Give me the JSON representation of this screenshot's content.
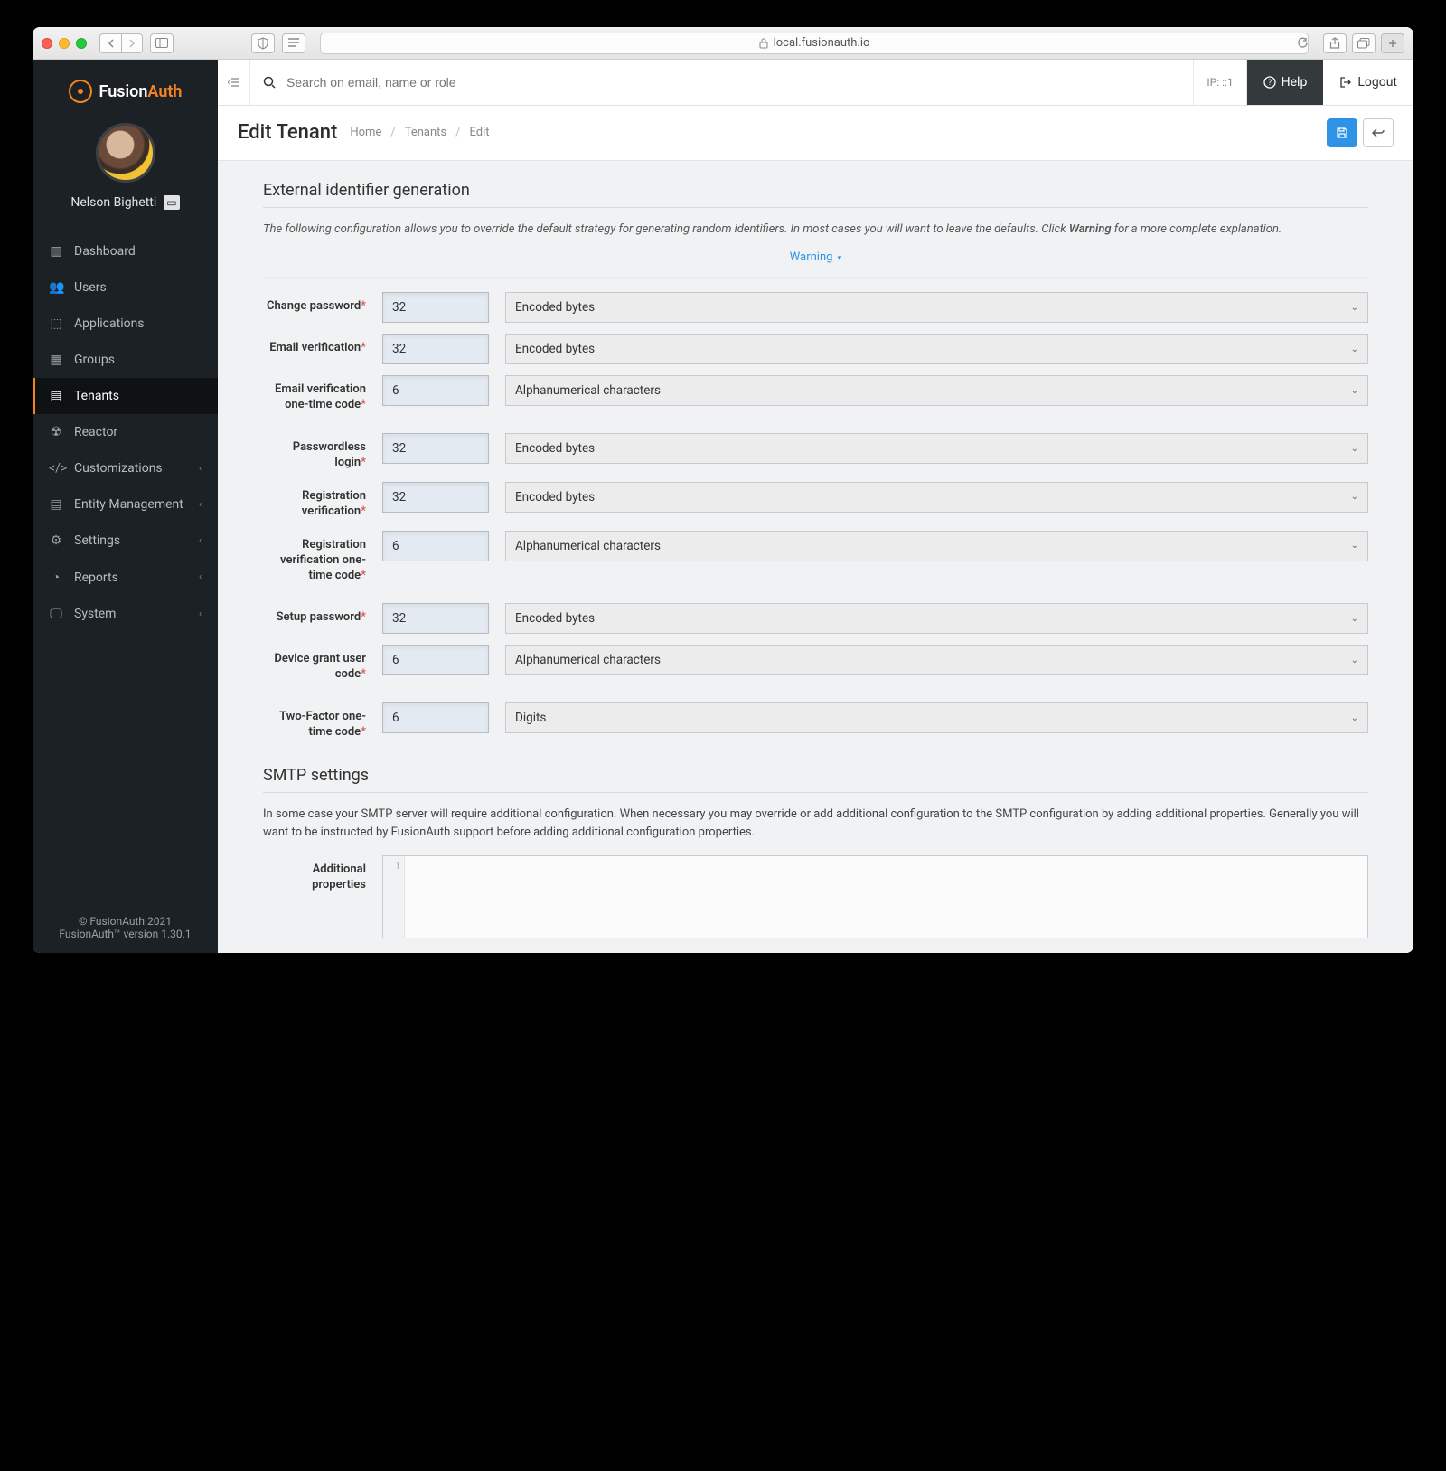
{
  "browser": {
    "url": "local.fusionauth.io"
  },
  "brand": {
    "name_left": "Fusion",
    "name_right": "Auth"
  },
  "user": {
    "name": "Nelson Bighetti"
  },
  "sidebar": {
    "items": [
      {
        "label": "Dashboard",
        "icon": "dashboard"
      },
      {
        "label": "Users",
        "icon": "users"
      },
      {
        "label": "Applications",
        "icon": "cube"
      },
      {
        "label": "Groups",
        "icon": "groups"
      },
      {
        "label": "Tenants",
        "icon": "server",
        "active": true
      },
      {
        "label": "Reactor",
        "icon": "radiation"
      },
      {
        "label": "Customizations",
        "icon": "code",
        "expandable": true
      },
      {
        "label": "Entity Management",
        "icon": "list",
        "expandable": true
      },
      {
        "label": "Settings",
        "icon": "sliders",
        "expandable": true
      },
      {
        "label": "Reports",
        "icon": "piechart",
        "expandable": true
      },
      {
        "label": "System",
        "icon": "monitor",
        "expandable": true
      }
    ]
  },
  "footer": {
    "copyright": "© FusionAuth 2021",
    "version": "FusionAuth™ version 1.30.1"
  },
  "topbar": {
    "search_placeholder": "Search on email, name or role",
    "ip": "IP: ::1",
    "help": "Help",
    "logout": "Logout"
  },
  "page": {
    "title": "Edit Tenant",
    "breadcrumb": [
      "Home",
      "Tenants",
      "Edit"
    ]
  },
  "sections": {
    "external": {
      "title": "External identifier generation",
      "desc_pre": "The following configuration allows you to override the default strategy for generating random identifiers. In most cases you will want to leave the defaults. Click ",
      "desc_bold": "Warning",
      "desc_post": " for a more complete explanation.",
      "warning_label": "Warning",
      "rows": [
        {
          "label": "Change password",
          "value": "32",
          "type": "Encoded bytes"
        },
        {
          "label": "Email verification",
          "value": "32",
          "type": "Encoded bytes"
        },
        {
          "label": "Email verification one-time code",
          "value": "6",
          "type": "Alphanumerical characters"
        },
        {
          "label": "Passwordless login",
          "value": "32",
          "type": "Encoded bytes"
        },
        {
          "label": "Registration verification",
          "value": "32",
          "type": "Encoded bytes"
        },
        {
          "label": "Registration verification one-time code",
          "value": "6",
          "type": "Alphanumerical characters"
        },
        {
          "label": "Setup password",
          "value": "32",
          "type": "Encoded bytes"
        },
        {
          "label": "Device grant user code",
          "value": "6",
          "type": "Alphanumerical characters"
        },
        {
          "label": "Two-Factor one-time code",
          "value": "6",
          "type": "Digits"
        }
      ]
    },
    "smtp": {
      "title": "SMTP settings",
      "desc": "In some case your SMTP server will require additional configuration. When necessary you may override or add additional configuration to the SMTP configuration by adding additional properties. Generally you will want to be instructed by FusionAuth support before adding additional configuration properties.",
      "additional_label": "Additional properties",
      "gutter": "1"
    }
  }
}
